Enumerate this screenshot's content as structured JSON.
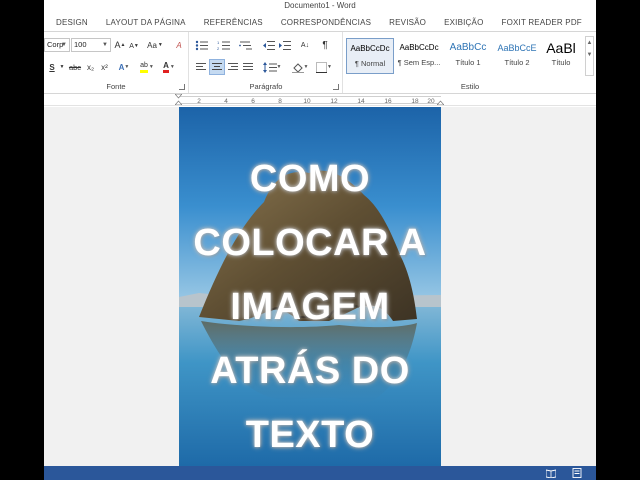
{
  "window": {
    "title": "Documento1 - Word"
  },
  "tabs": [
    "DESIGN",
    "LAYOUT DA PÁGINA",
    "REFERÊNCIAS",
    "CORRESPONDÊNCIAS",
    "REVISÃO",
    "EXIBIÇÃO",
    "FOXIT READER PDF"
  ],
  "ribbon": {
    "font": {
      "font_name": "Corp",
      "font_size": "100",
      "grow_label": "A",
      "shrink_label": "A",
      "case_label": "Aa",
      "clear_label": "A",
      "underline_label": "S",
      "strike_label": "abc",
      "subscript_label": "x₂",
      "superscript_label": "x²",
      "effects_label": "A",
      "highlight_label": "ab",
      "color_label": "A",
      "group_label": "Fonte"
    },
    "paragraph": {
      "sort_label": "A↓",
      "pilcrow_label": "¶",
      "group_label": "Parágrafo"
    },
    "styles": {
      "items": [
        {
          "sample": "AaBbCcDc",
          "name": "¶ Normal"
        },
        {
          "sample": "AaBbCcDc",
          "name": "¶ Sem Esp..."
        },
        {
          "sample": "AaBbCc",
          "name": "Título 1"
        },
        {
          "sample": "AaBbCcE",
          "name": "Título 2"
        },
        {
          "sample": "AaBl",
          "name": "Título"
        }
      ],
      "group_label": "Estilo"
    }
  },
  "ruler": {
    "numbers": [
      "2",
      "4",
      "6",
      "8",
      "10",
      "12",
      "14",
      "16",
      "18",
      "20"
    ]
  },
  "document": {
    "lines": [
      "COMO",
      "COLOCAR A",
      "IMAGEM",
      "ATRÁS DO",
      "TEXTO"
    ]
  },
  "colors": {
    "accent": "#2b579a",
    "sky_top": "#1f6fb3",
    "water": "#2f8dbf",
    "rock": "#6b5a3e",
    "text_glow": "#c9c9c9"
  },
  "icons": [
    "bullets-icon",
    "numbering-icon",
    "multilevel-icon",
    "decrease-indent-icon",
    "increase-indent-icon",
    "sort-icon",
    "pilcrow-icon",
    "align-left-icon",
    "align-center-icon",
    "align-right-icon",
    "justify-icon",
    "line-spacing-icon",
    "shading-icon",
    "borders-icon",
    "read-mode-icon",
    "print-layout-icon"
  ]
}
